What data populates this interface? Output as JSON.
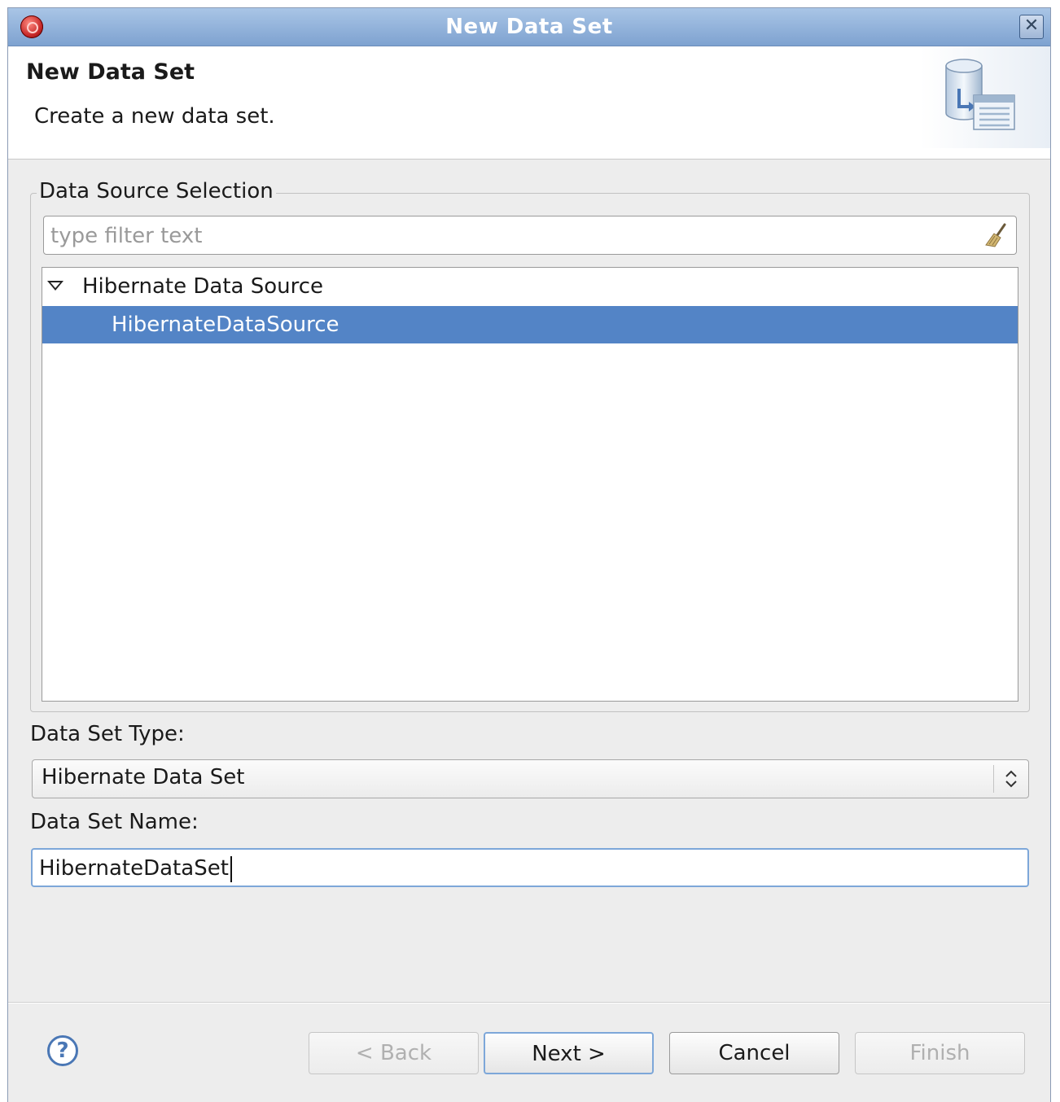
{
  "window": {
    "title": "New Data Set",
    "close_glyph": "✕"
  },
  "header": {
    "title": "New Data Set",
    "subtitle": "Create a new data set."
  },
  "data_source_group": {
    "legend": "Data Source Selection",
    "filter": {
      "placeholder": "type filter text",
      "value": ""
    },
    "tree": {
      "parent": {
        "label": "Hibernate Data Source",
        "expanded": true
      },
      "child": {
        "label": "HibernateDataSource",
        "selected": true
      }
    }
  },
  "data_set_type": {
    "label": "Data Set Type:",
    "value": "Hibernate Data Set"
  },
  "data_set_name": {
    "label": "Data Set Name:",
    "value": "HibernateDataSet"
  },
  "footer": {
    "help_glyph": "?",
    "back": "< Back",
    "next": "Next >",
    "cancel": "Cancel",
    "finish": "Finish"
  },
  "colors": {
    "selection": "#5384c6",
    "titlebar": "#7ea2d0",
    "focus_border": "#7da7d9"
  }
}
